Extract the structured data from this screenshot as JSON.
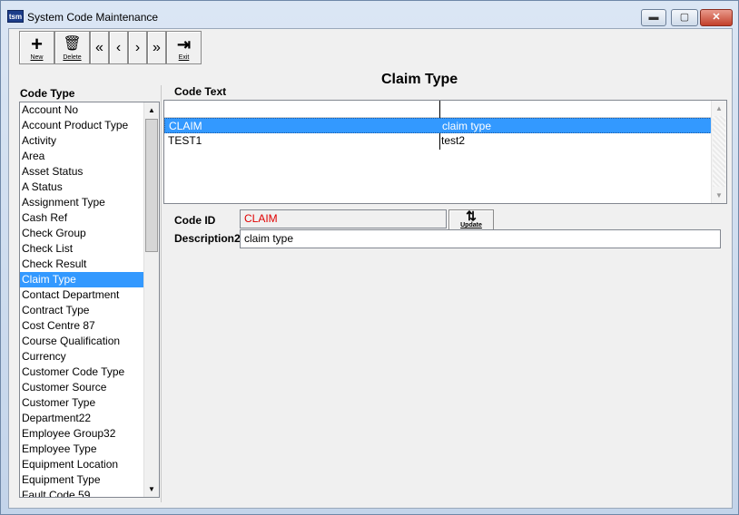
{
  "window": {
    "app_icon_text": "tsm",
    "title": "System Code Maintenance",
    "min_glyph": "▬",
    "max_glyph": "▢",
    "close_glyph": "✕"
  },
  "toolbar": {
    "new_glyph": "+",
    "new_label": "New",
    "delete_glyph": "🗑",
    "delete_label": "Delete",
    "first_glyph": "«",
    "prev_glyph": "‹",
    "next_glyph": "›",
    "last_glyph": "»",
    "exit_glyph": "⇥",
    "exit_label": "Exit"
  },
  "code_type": {
    "label": "Code Type",
    "items": [
      "Account No",
      "Account Product Type",
      "Activity",
      "Area",
      "Asset Status",
      "A Status",
      "Assignment Type",
      "Cash Ref",
      "Check Group",
      "Check List",
      "Check Result",
      "Claim Type",
      "Contact Department",
      "Contract Type",
      "Cost Centre 87",
      "Course Qualification",
      "Currency",
      "Customer Code Type",
      "Customer Source",
      "Customer Type",
      "Department22",
      "Employee Group32",
      "Employee Type",
      "Equipment Location",
      "Equipment Type",
      "Fault Code 59"
    ],
    "selected": "Claim Type"
  },
  "heading": "Claim Type",
  "code_text": {
    "label": "Code Text",
    "rows": [
      {
        "code": "CLAIM",
        "description": "claim type",
        "selected": true
      },
      {
        "code": "TEST1",
        "description": "test2",
        "selected": false
      }
    ]
  },
  "form": {
    "code_id_label": "Code ID",
    "code_id_value": "CLAIM",
    "description_label": "Description2",
    "description_value": "claim type",
    "update_glyph": "⇅",
    "update_label": "Update"
  },
  "scroll_glyphs": {
    "up": "▲",
    "down": "▼"
  },
  "colors": {
    "selection": "#3399ff",
    "code_id_text": "#e00000"
  }
}
